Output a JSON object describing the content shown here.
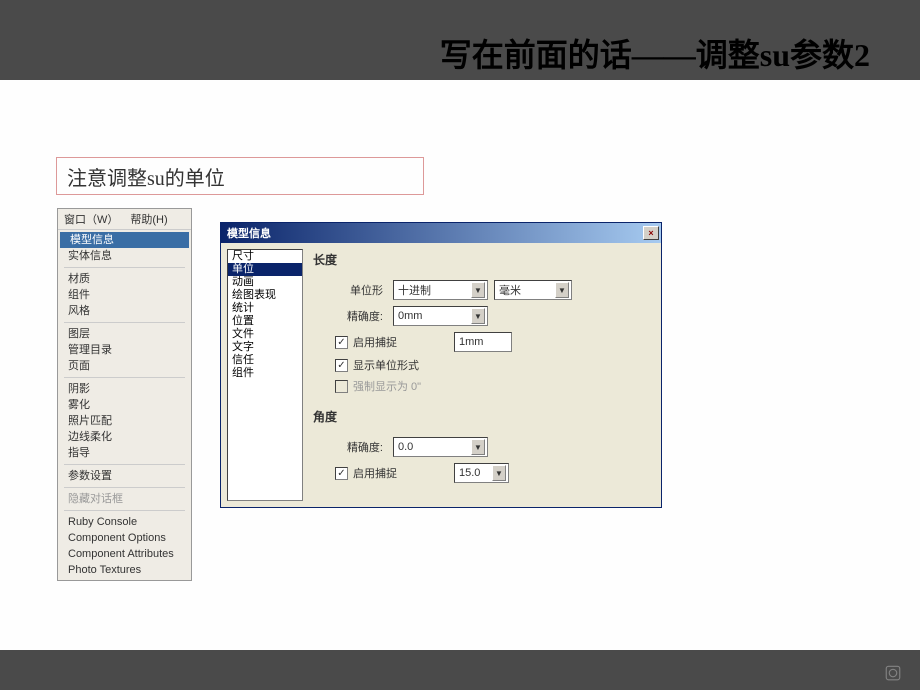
{
  "page": {
    "title": "写在前面的话——调整su参数2",
    "callout": "注意调整su的单位"
  },
  "menu": {
    "tab1": "窗口（W）",
    "tab2": "帮助(H)",
    "items": {
      "model_info": "模型信息",
      "entity_info": "实体信息",
      "materials": "材质",
      "components": "组件",
      "styles": "风格",
      "layers": "图层",
      "outliner": "管理目录",
      "pages": "页面",
      "shadows": "阴影",
      "fog": "雾化",
      "match_photo": "照片匹配",
      "soften": "边线柔化",
      "instructor": "指导",
      "preferences": "参数设置",
      "hide_dialogs": "隐藏对话框",
      "ruby_console": "Ruby Console",
      "comp_options": "Component Options",
      "comp_attributes": "Component Attributes",
      "photo_textures": "Photo Textures"
    }
  },
  "dialog": {
    "title": "模型信息",
    "close": "×",
    "sidebar": {
      "dimensions": "尺寸",
      "units": "单位",
      "animation": "动画",
      "rendering": "绘图表现",
      "statistics": "统计",
      "location": "位置",
      "file": "文件",
      "text": "文字",
      "credits": "信任",
      "components": "组件"
    },
    "length_section": "长度",
    "unit_format_label": "单位形",
    "unit_format_value": "十进制",
    "unit_type_value": "毫米",
    "precision_label": "精确度:",
    "length_precision_value": "0mm",
    "enable_snap_label": "启用捕捉",
    "snap_length_value": "1mm",
    "display_units_label": "显示单位形式",
    "force_display_label": "强制显示为 0\"",
    "angle_section": "角度",
    "angle_precision_value": "0.0",
    "angle_snap_value": "15.0"
  }
}
